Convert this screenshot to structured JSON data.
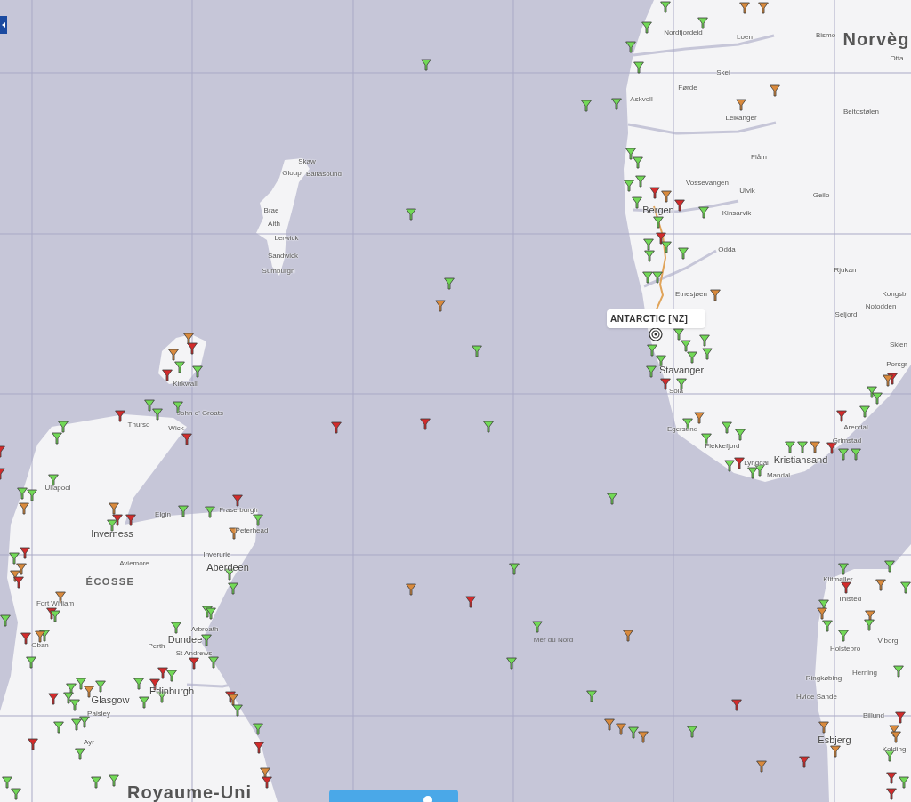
{
  "map": {
    "labels": [
      {
        "kind": "country",
        "text": "Norvèg"
      },
      {
        "kind": "country",
        "text": "Royaume-Uni"
      },
      {
        "kind": "region",
        "text": "ÉCOSSE"
      },
      {
        "kind": "sea",
        "text": "Mer du Nord"
      },
      {
        "kind": "city_major",
        "text": "Bergen"
      },
      {
        "kind": "city_major",
        "text": "Stavanger"
      },
      {
        "kind": "city_major",
        "text": "Kristiansand"
      },
      {
        "kind": "city_major",
        "text": "Inverness"
      },
      {
        "kind": "city_major",
        "text": "Aberdeen"
      },
      {
        "kind": "city_major",
        "text": "Dundee"
      },
      {
        "kind": "city_major",
        "text": "Edinburgh"
      },
      {
        "kind": "city_major",
        "text": "Glasgow"
      },
      {
        "kind": "city_major",
        "text": "Esbjerg"
      },
      {
        "kind": "city",
        "text": "Nordfjordeid"
      },
      {
        "kind": "city",
        "text": "Loen"
      },
      {
        "kind": "city",
        "text": "Bismo"
      },
      {
        "kind": "city",
        "text": "Otta"
      },
      {
        "kind": "city",
        "text": "Skei"
      },
      {
        "kind": "city",
        "text": "Førde"
      },
      {
        "kind": "city",
        "text": "Askvoll"
      },
      {
        "kind": "city",
        "text": "Beitostølen"
      },
      {
        "kind": "city",
        "text": "Leikanger"
      },
      {
        "kind": "city",
        "text": "Flåm"
      },
      {
        "kind": "city",
        "text": "Vossevangen"
      },
      {
        "kind": "city",
        "text": "Ulvik"
      },
      {
        "kind": "city",
        "text": "Geilo"
      },
      {
        "kind": "city",
        "text": "Kinsarvik"
      },
      {
        "kind": "city",
        "text": "Odda"
      },
      {
        "kind": "city",
        "text": "Rjukan"
      },
      {
        "kind": "city",
        "text": "Etnesjøen"
      },
      {
        "kind": "city",
        "text": "Kongsb"
      },
      {
        "kind": "city",
        "text": "Notodden"
      },
      {
        "kind": "city",
        "text": "Seljord"
      },
      {
        "kind": "city",
        "text": "Skien"
      },
      {
        "kind": "city",
        "text": "Porsgr"
      },
      {
        "kind": "city",
        "text": "Sola"
      },
      {
        "kind": "city",
        "text": "Egersund"
      },
      {
        "kind": "city",
        "text": "Flekkefjord"
      },
      {
        "kind": "city",
        "text": "Lyngdal"
      },
      {
        "kind": "city",
        "text": "Mandal"
      },
      {
        "kind": "city",
        "text": "Arendal"
      },
      {
        "kind": "city",
        "text": "Grimstad"
      },
      {
        "kind": "city",
        "text": "Klitmøller"
      },
      {
        "kind": "city",
        "text": "Thisted"
      },
      {
        "kind": "city",
        "text": "Viborg"
      },
      {
        "kind": "city",
        "text": "Holstebro"
      },
      {
        "kind": "city",
        "text": "Herning"
      },
      {
        "kind": "city",
        "text": "Ringkøbing"
      },
      {
        "kind": "city",
        "text": "Hvide Sande"
      },
      {
        "kind": "city",
        "text": "Billund"
      },
      {
        "kind": "city",
        "text": "Kolding"
      },
      {
        "kind": "city",
        "text": "Skaw"
      },
      {
        "kind": "city",
        "text": "Gloup"
      },
      {
        "kind": "city",
        "text": "Baltasound"
      },
      {
        "kind": "city",
        "text": "Brae"
      },
      {
        "kind": "city",
        "text": "Aith"
      },
      {
        "kind": "city",
        "text": "Lerwick"
      },
      {
        "kind": "city",
        "text": "Sandwick"
      },
      {
        "kind": "city",
        "text": "Sumburgh"
      },
      {
        "kind": "city",
        "text": "Kirkwall"
      },
      {
        "kind": "city",
        "text": "Thurso"
      },
      {
        "kind": "city",
        "text": "John o' Groats"
      },
      {
        "kind": "city",
        "text": "Wick"
      },
      {
        "kind": "city",
        "text": "Ullapool"
      },
      {
        "kind": "city",
        "text": "Elgin"
      },
      {
        "kind": "city",
        "text": "Fraserburgh"
      },
      {
        "kind": "city",
        "text": "Peterhead"
      },
      {
        "kind": "city",
        "text": "Inverurie"
      },
      {
        "kind": "city",
        "text": "Aviemore"
      },
      {
        "kind": "city",
        "text": "Fort William"
      },
      {
        "kind": "city",
        "text": "Oban"
      },
      {
        "kind": "city",
        "text": "Arbroath"
      },
      {
        "kind": "city",
        "text": "Perth"
      },
      {
        "kind": "city",
        "text": "St Andrews"
      },
      {
        "kind": "city",
        "text": "Paisley"
      },
      {
        "kind": "city",
        "text": "Ayr"
      }
    ],
    "ships": [
      {
        "color": "#72d957"
      },
      {
        "color": "#d98a3d"
      },
      {
        "color": "#d98a3d"
      },
      {
        "color": "#72d957"
      },
      {
        "color": "#72d957"
      },
      {
        "color": "#72d957"
      },
      {
        "color": "#72d957"
      },
      {
        "color": "#d98a3d"
      },
      {
        "color": "#72d957"
      },
      {
        "color": "#72d957"
      },
      {
        "color": "#d98a3d"
      },
      {
        "color": "#72d957"
      },
      {
        "color": "#72d957"
      },
      {
        "color": "#72d957"
      },
      {
        "color": "#72d957"
      },
      {
        "color": "#72d957"
      },
      {
        "color": "#d22b2b"
      },
      {
        "color": "#d22b2b"
      },
      {
        "color": "#d98a3d"
      },
      {
        "color": "#72d957"
      },
      {
        "color": "#72d957"
      },
      {
        "color": "#72d957"
      },
      {
        "color": "#d22b2b"
      },
      {
        "color": "#72d957"
      },
      {
        "color": "#72d957"
      },
      {
        "color": "#72d957"
      },
      {
        "color": "#72d957"
      },
      {
        "color": "#72d957"
      },
      {
        "color": "#72d957"
      },
      {
        "color": "#d98a3d"
      },
      {
        "color": "#72d957"
      },
      {
        "color": "#72d957"
      },
      {
        "color": "#d98a3d"
      },
      {
        "color": "#72d957"
      },
      {
        "color": "#72d957"
      },
      {
        "color": "#72d957"
      },
      {
        "color": "#72d957"
      },
      {
        "color": "#72d957"
      },
      {
        "color": "#72d957"
      },
      {
        "color": "#72d957"
      },
      {
        "color": "#72d957"
      },
      {
        "color": "#72d957"
      },
      {
        "color": "#d22b2b"
      },
      {
        "color": "#72d957"
      },
      {
        "color": "#d22b2b"
      },
      {
        "color": "#d98a3d"
      },
      {
        "color": "#72d957"
      },
      {
        "color": "#72d957"
      },
      {
        "color": "#72d957"
      },
      {
        "color": "#d22b2b"
      },
      {
        "color": "#d22b2b"
      },
      {
        "color": "#72d957"
      },
      {
        "color": "#72d957"
      },
      {
        "color": "#72d957"
      },
      {
        "color": "#d98a3d"
      },
      {
        "color": "#72d957"
      },
      {
        "color": "#72d957"
      },
      {
        "color": "#72d957"
      },
      {
        "color": "#72d957"
      },
      {
        "color": "#d22b2b"
      },
      {
        "color": "#72d957"
      },
      {
        "color": "#72d957"
      },
      {
        "color": "#72d957"
      },
      {
        "color": "#72d957"
      },
      {
        "color": "#d98a3d"
      },
      {
        "color": "#d22b2b"
      },
      {
        "color": "#d22b2b"
      },
      {
        "color": "#72d957"
      },
      {
        "color": "#72d957"
      },
      {
        "color": "#72d957"
      },
      {
        "color": "#d98a3d"
      },
      {
        "color": "#d22b2b"
      },
      {
        "color": "#72d957"
      },
      {
        "color": "#d98a3d"
      },
      {
        "color": "#72d957"
      },
      {
        "color": "#72d957"
      },
      {
        "color": "#d22b2b"
      },
      {
        "color": "#d98a3d"
      },
      {
        "color": "#d98a3d"
      },
      {
        "color": "#72d957"
      },
      {
        "color": "#d98a3d"
      },
      {
        "color": "#72d957"
      },
      {
        "color": "#d98a3d"
      },
      {
        "color": "#d22b2b"
      },
      {
        "color": "#72d957"
      },
      {
        "color": "#72d957"
      },
      {
        "color": "#d22b2b"
      },
      {
        "color": "#d98a3d"
      },
      {
        "color": "#72d957"
      },
      {
        "color": "#72d957"
      },
      {
        "color": "#d98a3d"
      },
      {
        "color": "#d98a3d"
      },
      {
        "color": "#72d957"
      },
      {
        "color": "#72d957"
      },
      {
        "color": "#72d957"
      },
      {
        "color": "#72d957"
      },
      {
        "color": "#d22b2b"
      },
      {
        "color": "#d98a3d"
      },
      {
        "color": "#d98a3d"
      },
      {
        "color": "#d98a3d"
      },
      {
        "color": "#d98a3d"
      },
      {
        "color": "#72d957"
      },
      {
        "color": "#d22b2b"
      },
      {
        "color": "#72d957"
      },
      {
        "color": "#d22b2b"
      },
      {
        "color": "#d22b2b"
      },
      {
        "color": "#72d957"
      },
      {
        "color": "#d22b2b"
      },
      {
        "color": "#72d957"
      },
      {
        "color": "#72d957"
      },
      {
        "color": "#72d957"
      },
      {
        "color": "#d22b2b"
      },
      {
        "color": "#72d957"
      },
      {
        "color": "#d98a3d"
      },
      {
        "color": "#d22b2b"
      },
      {
        "color": "#d98a3d"
      },
      {
        "color": "#72d957"
      },
      {
        "color": "#d22b2b"
      },
      {
        "color": "#72d957"
      },
      {
        "color": "#72d957"
      },
      {
        "color": "#72d957"
      },
      {
        "color": "#72d957"
      },
      {
        "color": "#d98a3d"
      },
      {
        "color": "#d98a3d"
      },
      {
        "color": "#d22b2b"
      },
      {
        "color": "#d22b2b"
      },
      {
        "color": "#72d957"
      },
      {
        "color": "#72d957"
      },
      {
        "color": "#72d957"
      },
      {
        "color": "#d22b2b"
      },
      {
        "color": "#72d957"
      },
      {
        "color": "#d98a3d"
      },
      {
        "color": "#72d957"
      },
      {
        "color": "#72d957"
      },
      {
        "color": "#d22b2b"
      },
      {
        "color": "#72d957"
      },
      {
        "color": "#d22b2b"
      },
      {
        "color": "#d98a3d"
      },
      {
        "color": "#d98a3d"
      },
      {
        "color": "#d22b2b"
      },
      {
        "color": "#d98a3d"
      },
      {
        "color": "#d22b2b"
      },
      {
        "color": "#72d957"
      },
      {
        "color": "#72d957"
      },
      {
        "color": "#72d957"
      },
      {
        "color": "#d98a3d"
      },
      {
        "color": "#d22b2b"
      },
      {
        "color": "#72d957"
      },
      {
        "color": "#72d957"
      },
      {
        "color": "#72d957"
      },
      {
        "color": "#72d957"
      },
      {
        "color": "#72d957"
      },
      {
        "color": "#72d957"
      },
      {
        "color": "#d22b2b"
      },
      {
        "color": "#d22b2b"
      },
      {
        "color": "#72d957"
      },
      {
        "color": "#72d957"
      },
      {
        "color": "#d22b2b"
      },
      {
        "color": "#72d957"
      },
      {
        "color": "#72d957"
      },
      {
        "color": "#72d957"
      },
      {
        "color": "#72d957"
      },
      {
        "color": "#d98a3d"
      },
      {
        "color": "#72d957"
      },
      {
        "color": "#72d957"
      },
      {
        "color": "#72d957"
      },
      {
        "color": "#72d957"
      },
      {
        "color": "#d22b2b"
      },
      {
        "color": "#72d957"
      },
      {
        "color": "#72d957"
      },
      {
        "color": "#72d957"
      },
      {
        "color": "#d22b2b"
      },
      {
        "color": "#d22b2b"
      },
      {
        "color": "#d98a3d"
      },
      {
        "color": "#72d957"
      },
      {
        "color": "#72d957"
      },
      {
        "color": "#d22b2b"
      },
      {
        "color": "#d98a3d"
      },
      {
        "color": "#d22b2b"
      },
      {
        "color": "#72d957"
      },
      {
        "color": "#72d957"
      },
      {
        "color": "#72d957"
      },
      {
        "color": "#72d957"
      }
    ],
    "vessel_label": {
      "text": "ANTARCTIC [NZ]"
    }
  }
}
